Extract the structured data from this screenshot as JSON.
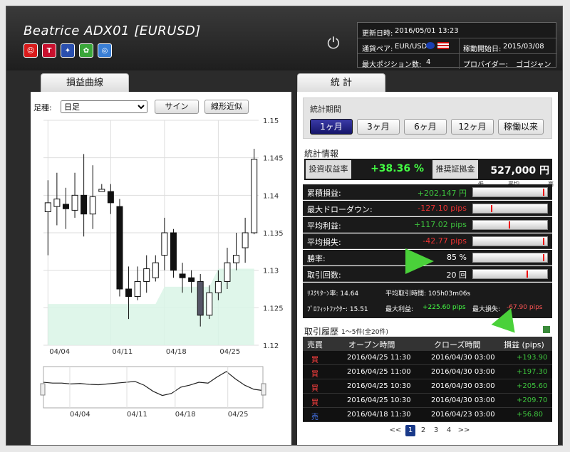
{
  "header": {
    "title": "Beatrice ADX01 [EURUSD]",
    "icons": [
      {
        "name": "smile-icon",
        "color": "#d81b1b",
        "glyph": "☺"
      },
      {
        "name": "t100-icon",
        "color": "#c8102e",
        "glyph": "T"
      },
      {
        "name": "chart-badge-icon",
        "color": "#2a4fae",
        "glyph": "✦"
      },
      {
        "name": "leaf-icon",
        "color": "#3aa63a",
        "glyph": "✿"
      },
      {
        "name": "globe-icon",
        "color": "#3a7fd5",
        "glyph": "◎"
      }
    ],
    "power_icon": "⏻"
  },
  "info": {
    "updated_label": "更新日時:",
    "updated_value": "2016/05/01 13:23",
    "pair_label": "通貨ペア:",
    "pair_value": "EUR/USD",
    "start_label": "稼動開始日:",
    "start_value": "2015/03/08",
    "maxpos_label": "最大ポジション数:",
    "maxpos_value": "4",
    "provider_label": "プロバイダー:",
    "provider_value": "ゴゴジャン"
  },
  "left": {
    "tab": "損益曲線",
    "bar_label": "足種:",
    "bar_value": "日足",
    "sign_button": "サイン",
    "trend_button": "線形近似"
  },
  "chart_data": {
    "type": "candlestick",
    "y_ticks": [
      "1.15",
      "1.145",
      "1.14",
      "1.135",
      "1.13",
      "1.125",
      "1.12"
    ],
    "ylim": [
      1.12,
      1.15
    ],
    "x_ticks": [
      "04/04",
      "04/11",
      "04/18",
      "04/25"
    ],
    "mini_x_ticks": [
      "04/04",
      "04/11",
      "04/18",
      "04/25"
    ],
    "candles": [
      {
        "o": 1.1378,
        "c": 1.139,
        "h": 1.142,
        "l": 1.132
      },
      {
        "o": 1.1385,
        "c": 1.1395,
        "h": 1.143,
        "l": 1.136
      },
      {
        "o": 1.1388,
        "c": 1.1382,
        "h": 1.141,
        "l": 1.1355
      },
      {
        "o": 1.138,
        "c": 1.14,
        "h": 1.143,
        "l": 1.137
      },
      {
        "o": 1.14,
        "c": 1.1375,
        "h": 1.1455,
        "l": 1.1345
      },
      {
        "o": 1.1375,
        "c": 1.1398,
        "h": 1.144,
        "l": 1.1355
      },
      {
        "o": 1.1405,
        "c": 1.1408,
        "h": 1.1415,
        "l": 1.1405
      },
      {
        "o": 1.1405,
        "c": 1.139,
        "h": 1.1415,
        "l": 1.1375
      },
      {
        "o": 1.1385,
        "c": 1.1275,
        "h": 1.1395,
        "l": 1.1265
      },
      {
        "o": 1.1275,
        "c": 1.1265,
        "h": 1.1305,
        "l": 1.1235
      },
      {
        "o": 1.1265,
        "c": 1.1285,
        "h": 1.1305,
        "l": 1.126
      },
      {
        "o": 1.1285,
        "c": 1.1302,
        "h": 1.132,
        "l": 1.127
      },
      {
        "o": 1.129,
        "c": 1.131,
        "h": 1.132,
        "l": 1.1285
      },
      {
        "o": 1.132,
        "c": 1.135,
        "h": 1.137,
        "l": 1.13
      },
      {
        "o": 1.135,
        "c": 1.13,
        "h": 1.1355,
        "l": 1.129
      },
      {
        "o": 1.1295,
        "c": 1.129,
        "h": 1.131,
        "l": 1.127
      },
      {
        "o": 1.129,
        "c": 1.1285,
        "h": 1.13,
        "l": 1.127
      },
      {
        "o": 1.1285,
        "c": 1.124,
        "h": 1.1295,
        "l": 1.1225
      },
      {
        "o": 1.124,
        "c": 1.127,
        "h": 1.128,
        "l": 1.1235
      },
      {
        "o": 1.127,
        "c": 1.1285,
        "h": 1.13,
        "l": 1.126
      },
      {
        "o": 1.1285,
        "c": 1.131,
        "h": 1.133,
        "l": 1.1275
      },
      {
        "o": 1.131,
        "c": 1.132,
        "h": 1.135,
        "l": 1.13
      },
      {
        "o": 1.133,
        "c": 1.135,
        "h": 1.137,
        "l": 1.131
      },
      {
        "o": 1.135,
        "c": 1.1448,
        "h": 1.1462,
        "l": 1.1348
      }
    ],
    "area": [
      1.1255,
      1.1255,
      1.1255,
      1.1255,
      1.1255,
      1.1255,
      1.1255,
      1.1255,
      1.1255,
      1.1255,
      1.1255,
      1.1255,
      1.1255,
      1.1278,
      1.1278,
      1.1278,
      1.1278,
      1.1278,
      1.1278,
      1.1302,
      1.1302,
      1.1302,
      1.1302,
      1.1302
    ],
    "mini_line": [
      0.62,
      0.6,
      0.6,
      0.58,
      0.59,
      0.57,
      0.56,
      0.58,
      0.6,
      0.62,
      0.64,
      0.55,
      0.4,
      0.3,
      0.35,
      0.5,
      0.55,
      0.62,
      0.6,
      0.75,
      0.88,
      0.7,
      0.55,
      0.45,
      0.42
    ]
  },
  "right": {
    "tab": "統 計",
    "period_label": "統計期間",
    "periods": [
      "1ヶ月",
      "3ヶ月",
      "6ヶ月",
      "12ヶ月",
      "稼働以来"
    ],
    "stats_title": "統計情報",
    "roi_label": "投資収益率",
    "roi_value": "+38.36 %",
    "margin_label": "推奨証拠金",
    "margin_value": "527,000 円",
    "scale_low": "低",
    "scale_avg": "平均",
    "scale_high": "高",
    "rows": [
      {
        "label": "累積損益:",
        "value": "+202,147 円",
        "color": "#3ec43e",
        "level": 0.98
      },
      {
        "label": "最大ドローダウン:",
        "value": "-127.10 pips",
        "color": "#e33",
        "level": 0.25
      },
      {
        "label": "平均利益:",
        "value": "+117.02 pips",
        "color": "#3ec43e",
        "level": 0.5
      },
      {
        "label": "平均損失:",
        "value": "-42.77 pips",
        "color": "#e33",
        "level": 0.98
      },
      {
        "label": "勝率:",
        "value": "85 %",
        "color": "#fff",
        "level": 0.98
      },
      {
        "label": "取引回数:",
        "value": "20 回",
        "color": "#fff",
        "level": 0.75
      }
    ],
    "risk_label": "ﾘｽｸﾘﾀｰﾝ率: 14.64",
    "avgtime_label": "平均取引時間: 105h03m06s",
    "pf_label": "ﾌﾟﾛﾌｨｯﾄﾌｧｸﾀｰ: 15.51",
    "maxprofit_label": "最大利益:",
    "maxprofit_value": "+225.60 pips",
    "maxloss_label": "最大損失:",
    "maxloss_value": "-67.90 pips",
    "history_title": "取引履歴",
    "history_count": "1～5件(全20件)",
    "history_headers": [
      "売買",
      "オープン時間",
      "クローズ時間",
      "損益 (pips)"
    ],
    "history": [
      {
        "side": "買",
        "open": "2016/04/25 11:30",
        "close": "2016/04/30 03:00",
        "pl": "+193.90"
      },
      {
        "side": "買",
        "open": "2016/04/25 11:00",
        "close": "2016/04/30 03:00",
        "pl": "+197.30"
      },
      {
        "side": "買",
        "open": "2016/04/25 10:30",
        "close": "2016/04/30 03:00",
        "pl": "+205.60"
      },
      {
        "side": "買",
        "open": "2016/04/25 10:30",
        "close": "2016/04/30 03:00",
        "pl": "+209.70"
      },
      {
        "side": "売",
        "open": "2016/04/18 11:30",
        "close": "2016/04/23 03:00",
        "pl": "+56.80"
      }
    ],
    "pager": {
      "prev": "<<",
      "pages": [
        "1",
        "2",
        "3",
        "4"
      ],
      "next": ">>",
      "current": "1"
    }
  },
  "colors": {
    "buy": "#ff4040",
    "sell": "#4a7fff",
    "green": "#3ec43e",
    "red": "#e33",
    "active": "#1a3a8a"
  }
}
